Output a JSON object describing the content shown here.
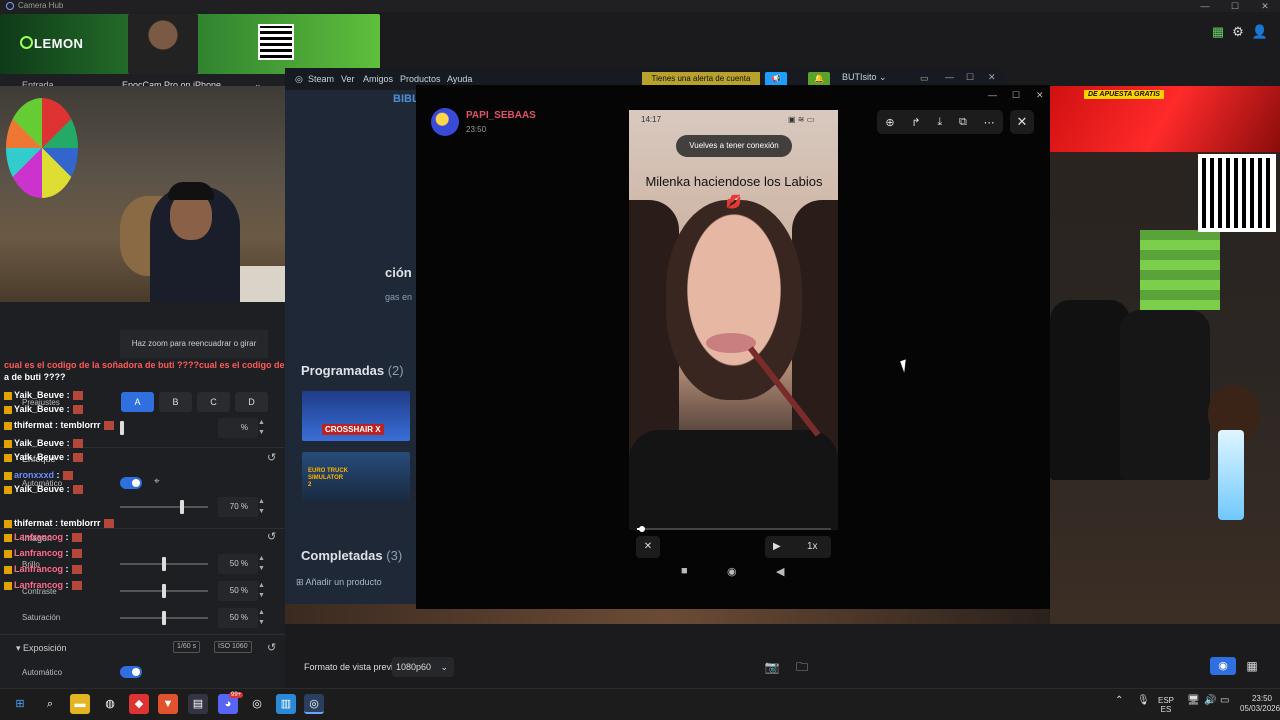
{
  "window": {
    "title": "Camera Hub"
  },
  "banner": {
    "brand": "LEMON"
  },
  "camera": {
    "input_label": "Entrada",
    "device": "EpocCam Pro on iPhone",
    "zoom_hint": "Haz zoom para reencuadrar o girar",
    "presets_label": "Preajustes",
    "presets": [
      "A",
      "B",
      "C",
      "D"
    ],
    "zoom_pct": "%",
    "focus_label": "Enfoque",
    "auto_label": "Automático",
    "auto_pct": "70 %",
    "image_label": "Imagen",
    "brightness_label": "Brillo",
    "brightness": "50 %",
    "contrast_label": "Contraste",
    "contrast": "50 %",
    "saturation_label": "Saturación",
    "saturation": "50 %",
    "exposure_label": "Exposición",
    "exposure_shutter": "1/60 s",
    "exposure_iso_label": "ISO",
    "exposure_iso": "1060",
    "exposure_auto_label": "Automático",
    "preview_format_label": "Formato de vista previa",
    "preview_format": "1080p60"
  },
  "chat": [
    {
      "user": "",
      "text": "cual es el codigo de la soñadora de buti ????cual es el codigo de",
      "color": "#ff5a5a"
    },
    {
      "user": "",
      "text": "a de buti ????",
      "color": "#ffffff"
    },
    {
      "user": "Yaik_Beuve",
      "text": ":",
      "color": "#ffffff"
    },
    {
      "user": "Yaik_Beuve",
      "text": ":",
      "color": "#ffffff"
    },
    {
      "user": "thifermat",
      "text": ": temblorrr",
      "color": "#ffffff"
    },
    {
      "user": "Yaik_Beuve",
      "text": ":",
      "color": "#ffffff"
    },
    {
      "user": "Yaik_Beuve",
      "text": ":",
      "color": "#ffffff"
    },
    {
      "user": "aronxxxd",
      "text": ":",
      "color": "#6a8cff"
    },
    {
      "user": "Yaik_Beuve",
      "text": ":",
      "color": "#ffffff"
    },
    {
      "user": "thifermat",
      "text": ": temblorrr",
      "color": "#ffffff"
    },
    {
      "user": "Lanfrancog",
      "text": ":",
      "color": "#ff6b8a"
    },
    {
      "user": "Lanfrancog",
      "text": ":",
      "color": "#ff6b8a"
    },
    {
      "user": "Lanfrancog",
      "text": ":",
      "color": "#ff6b8a"
    },
    {
      "user": "Lanfrancog",
      "text": ":",
      "color": "#ff6b8a"
    }
  ],
  "steam": {
    "menu": [
      "Steam",
      "Ver",
      "Amigos",
      "Productos",
      "Ayuda"
    ],
    "alert": "Tienes una alerta de cuenta",
    "user": "BUTIsito",
    "library_tab": "BIBL",
    "section_fragment": "ción",
    "section_fragment2": "gas en",
    "scheduled_label": "Programadas",
    "scheduled_count": "(2)",
    "games": [
      "CROSSHAIR X",
      "EURO TRUCK SIMULATOR 2"
    ],
    "completed_label": "Completadas",
    "completed_count": "(3)",
    "add_product": "Añadir un producto"
  },
  "overlay": {
    "promo": "DE APUESTA GRATIS"
  },
  "viewer": {
    "sender": "PAPI_SEBAAS",
    "time": "23:50",
    "phone_time": "14:17",
    "toast": "Vuelves a tener conexión",
    "caption": "Milenka haciendose los Labios 💋",
    "speed": "1x",
    "progress": 0.02
  },
  "taskbar": {
    "lang_top": "ESP",
    "lang_bottom": "ES",
    "time": "23:50",
    "date": "05/03/2026",
    "badge": "99+"
  }
}
